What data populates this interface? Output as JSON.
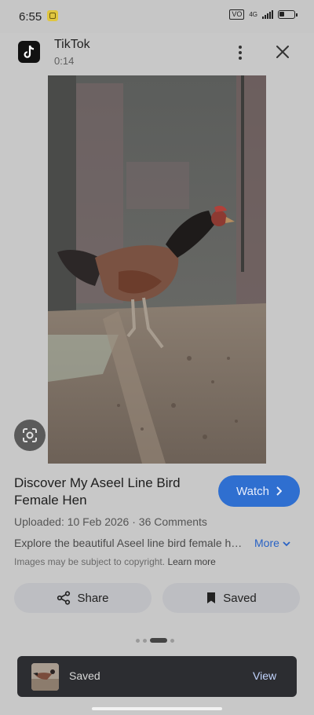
{
  "status_bar": {
    "time": "6:55",
    "network": "4G",
    "vo_badge": "VO"
  },
  "header": {
    "app_name": "TikTok",
    "duration": "0:14"
  },
  "video": {
    "title": "Discover My Aseel Line Bird Female Hen",
    "watch_label": "Watch",
    "meta": "Uploaded: 10 Feb 2026 · 36 Comments",
    "description": "Explore the beautiful Aseel line bird female hen in this video.",
    "more_label": "More",
    "copyright_text": "Images may be subject to copyright.",
    "learn_more": "Learn more"
  },
  "actions": {
    "share_label": "Share",
    "saved_label": "Saved"
  },
  "pager": {
    "count": 4,
    "active_index": 2
  },
  "snackbar": {
    "message": "Saved",
    "action": "View"
  },
  "colors": {
    "accent": "#2f6fd0",
    "snackbar_bg": "#2c2d31",
    "scrim": "#c8c8c8"
  },
  "icons": [
    "tiktok-logo-icon",
    "more-vert-icon",
    "close-icon",
    "lens-icon",
    "chevron-right-icon",
    "chevron-down-icon",
    "share-icon",
    "bookmark-icon"
  ]
}
